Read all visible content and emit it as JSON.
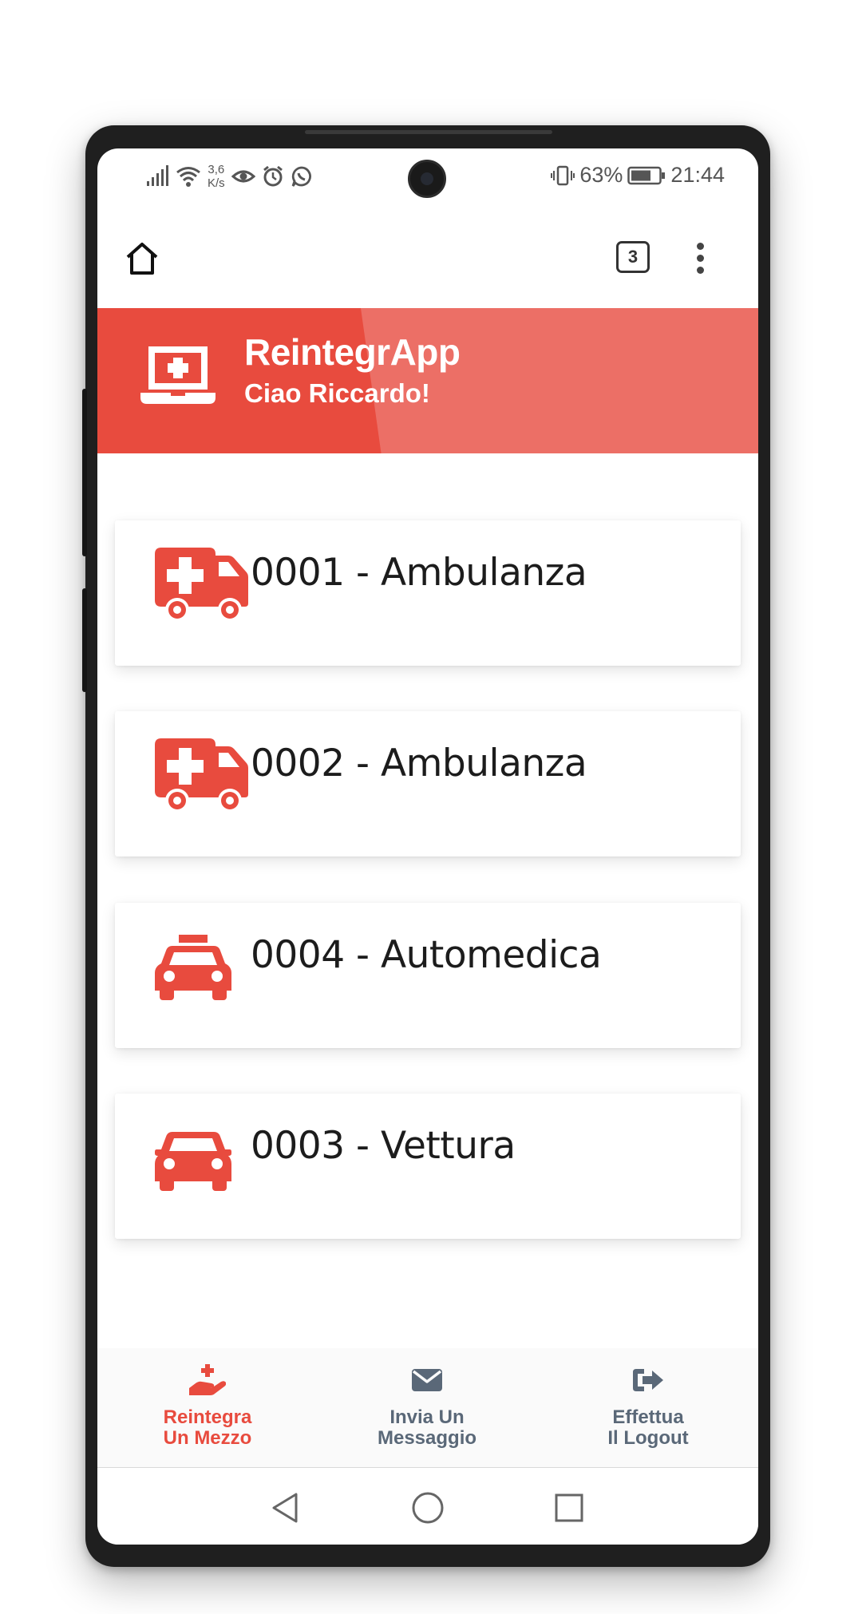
{
  "status_bar": {
    "net_speed_value": "3,6",
    "net_speed_unit": "K/s",
    "battery": "63%",
    "time": "21:44",
    "icons": [
      "signal-icon",
      "wifi-icon",
      "eye-icon",
      "alarm-icon",
      "whatsapp-icon",
      "vibrate-icon",
      "battery-icon"
    ]
  },
  "browser": {
    "tab_count": "3",
    "icons": [
      "home-icon",
      "tabs-icon",
      "more-vert-icon"
    ]
  },
  "header": {
    "title": "ReintegrApp",
    "greeting": "Ciao Riccardo!",
    "icon": "laptop-medical-icon",
    "color": "#e84b3e",
    "color_light": "#ec6f66"
  },
  "vehicles": [
    {
      "label": "0001 - Ambulanza",
      "icon": "ambulance-icon"
    },
    {
      "label": "0002 - Ambulanza",
      "icon": "ambulance-icon"
    },
    {
      "label": "0004 - Automedica",
      "icon": "taxi-icon"
    },
    {
      "label": "0003 - Vettura",
      "icon": "car-icon"
    }
  ],
  "bottom_nav": [
    {
      "label": "Reintegra\nUn Mezzo",
      "icon": "hand-holding-medical-icon",
      "active": true
    },
    {
      "label": "Invia Un\nMessaggio",
      "icon": "envelope-icon",
      "active": false
    },
    {
      "label": "Effettua\nIl Logout",
      "icon": "sign-out-icon",
      "active": false
    }
  ],
  "system_nav": {
    "icons": [
      "back-icon",
      "home-circle-icon",
      "recents-icon"
    ]
  },
  "colors": {
    "accent": "#e84b3e",
    "nav_inactive": "#5a6878"
  }
}
